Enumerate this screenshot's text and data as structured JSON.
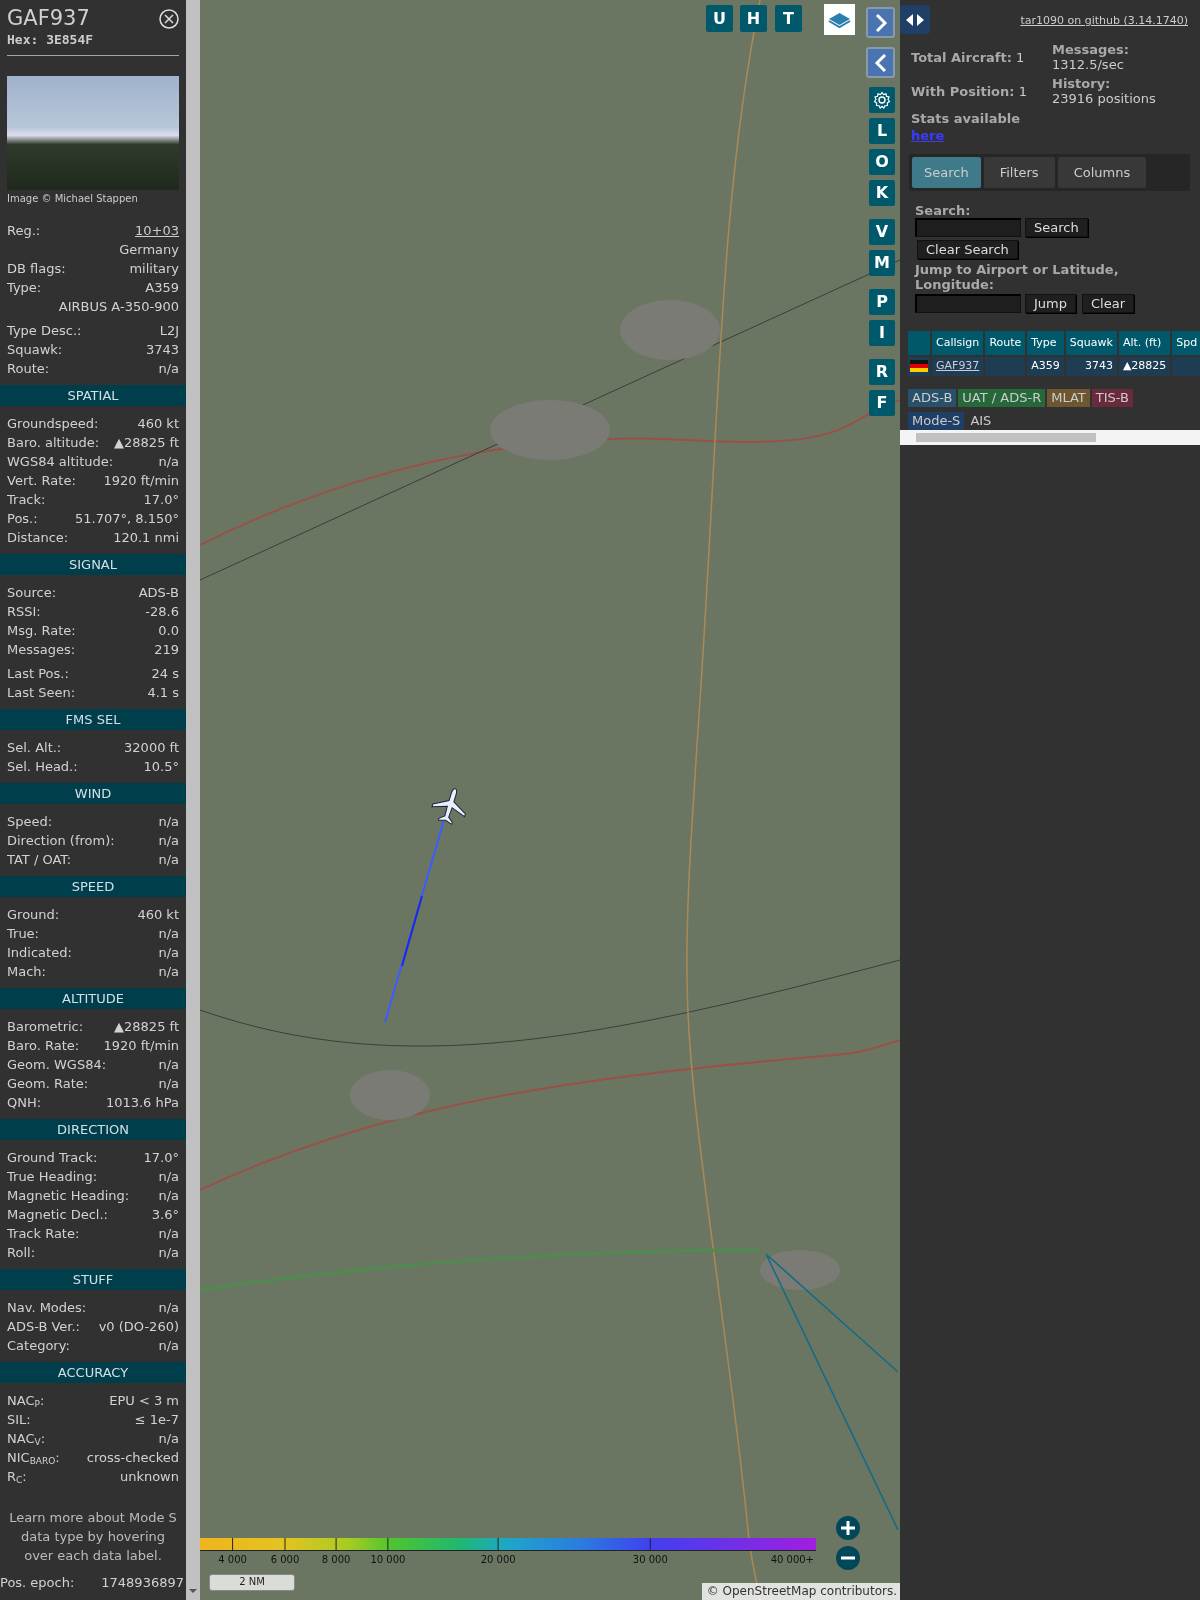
{
  "sidebar": {
    "callsign": "GAF937",
    "hex": "Hex: 3E854F",
    "photo_credit": "Image © Michael Stappen",
    "details": [
      [
        {
          "label": "Reg.:",
          "value": "10+03",
          "kind": "link"
        },
        {
          "value": "Germany",
          "kind": "plain"
        },
        {
          "label": "DB flags:",
          "value": "military",
          "kind": "plain"
        },
        {
          "label": "Type:",
          "value": "A359",
          "kind": "plain"
        },
        {
          "value": "AIRBUS A-350-900",
          "kind": "plain"
        }
      ],
      [
        {
          "label": "Type Desc.:",
          "value": "L2J",
          "kind": "plain"
        },
        {
          "label": "Squawk:",
          "value": "3743",
          "kind": "plain"
        },
        {
          "label": "Route:",
          "value": "n/a",
          "kind": "plain"
        }
      ]
    ],
    "sections": [
      {
        "title": "SPATIAL",
        "groups": [
          [
            {
              "label": "Groundspeed:",
              "value": "460 kt"
            },
            {
              "label": "Baro. altitude:",
              "value": "▲28825 ft"
            },
            {
              "label": "WGS84 altitude:",
              "value": "n/a"
            },
            {
              "label": "Vert. Rate:",
              "value": "1920 ft/min"
            },
            {
              "label": "Track:",
              "value": "17.0°"
            },
            {
              "label": "Pos.:",
              "value": "51.707°, 8.150°"
            },
            {
              "label": "Distance:",
              "value": "120.1 nmi"
            }
          ]
        ]
      },
      {
        "title": "SIGNAL",
        "groups": [
          [
            {
              "label": "Source:",
              "value": "ADS-B"
            },
            {
              "label": "RSSI:",
              "value": "-28.6"
            },
            {
              "label": "Msg. Rate:",
              "value": "0.0"
            },
            {
              "label": "Messages:",
              "value": "219"
            }
          ],
          [
            {
              "label": "Last Pos.:",
              "value": "24 s"
            },
            {
              "label": "Last Seen:",
              "value": "4.1 s"
            }
          ]
        ]
      },
      {
        "title": "FMS SEL",
        "groups": [
          [
            {
              "label": "Sel. Alt.:",
              "value": "32000 ft"
            },
            {
              "label": "Sel. Head.:",
              "value": "10.5°"
            }
          ]
        ]
      },
      {
        "title": "WIND",
        "groups": [
          [
            {
              "label": "Speed:",
              "value": "n/a"
            },
            {
              "label": "Direction (from):",
              "value": "n/a"
            },
            {
              "label": "TAT / OAT:",
              "value": "n/a"
            }
          ]
        ]
      },
      {
        "title": "SPEED",
        "groups": [
          [
            {
              "label": "Ground:",
              "value": "460 kt"
            },
            {
              "label": "True:",
              "value": "n/a"
            },
            {
              "label": "Indicated:",
              "value": "n/a"
            },
            {
              "label": "Mach:",
              "value": "n/a"
            }
          ]
        ]
      },
      {
        "title": "ALTITUDE",
        "groups": [
          [
            {
              "label": "Barometric:",
              "value": "▲28825 ft"
            },
            {
              "label": "Baro. Rate:",
              "value": "1920 ft/min"
            },
            {
              "label": "Geom. WGS84:",
              "value": "n/a"
            },
            {
              "label": "Geom. Rate:",
              "value": "n/a"
            },
            {
              "label": "QNH:",
              "value": "1013.6 hPa"
            }
          ]
        ]
      },
      {
        "title": "DIRECTION",
        "groups": [
          [
            {
              "label": "Ground Track:",
              "value": "17.0°"
            },
            {
              "label": "True Heading:",
              "value": "n/a"
            },
            {
              "label": "Magnetic Heading:",
              "value": "n/a"
            },
            {
              "label": "Magnetic Decl.:",
              "value": "3.6°"
            },
            {
              "label": "Track Rate:",
              "value": "n/a"
            },
            {
              "label": "Roll:",
              "value": "n/a"
            }
          ]
        ]
      },
      {
        "title": "STUFF",
        "groups": [
          [
            {
              "label": "Nav. Modes:",
              "value": "n/a"
            },
            {
              "label": "ADS-B Ver.:",
              "value": "v0 (DO-260)"
            },
            {
              "label": "Category:",
              "value": "n/a"
            }
          ]
        ]
      },
      {
        "title": "ACCURACY",
        "groups": [
          [
            {
              "label": "NAC$_{P}$:",
              "value": "EPU < 3 m"
            },
            {
              "label": "SIL:",
              "value": "≤ 1e-7"
            },
            {
              "label": "NAC$_{V}$:",
              "value": "n/a"
            },
            {
              "label": "NIC$_{BARO}$:",
              "value": "cross-checked"
            },
            {
              "label": "R$_{C}$:",
              "value": "unknown"
            }
          ]
        ]
      }
    ],
    "hint": "Learn more about Mode S data type by hovering over each data label.",
    "epoch": {
      "label": "Pos. epoch:",
      "value": "1748936897"
    }
  },
  "map": {
    "top_buttons": [
      "U",
      "H",
      "T"
    ],
    "side_button_groups": [
      [
        "L",
        "O",
        "K"
      ],
      [
        "V",
        "M"
      ],
      [
        "P",
        "I"
      ],
      [
        "R",
        "F"
      ]
    ],
    "altitude_legend": [
      "4 000",
      "6 000",
      "8 000",
      "10 000",
      "20 000",
      "30 000",
      "40 000+"
    ],
    "scale": "2 NM",
    "attribution": {
      "prefix": "©",
      "link": "OpenStreetMap",
      "suffix": "contributors."
    }
  },
  "panel": {
    "version_link": "tar1090 on github (3.14.1740)",
    "stats_left": [
      "**Total Aircraft:** 1",
      "**With Position:** 1"
    ],
    "stats_note": "Stats available",
    "stats_link": "here",
    "stats_right": [
      {
        "label": "Messages:",
        "value": "1312.5/sec"
      },
      {
        "label": "History:",
        "value": "23916 positions"
      }
    ],
    "tabs": [
      {
        "label": "Search",
        "selected": true
      },
      {
        "label": "Filters",
        "selected": false
      },
      {
        "label": "Columns",
        "selected": false
      }
    ],
    "search": {
      "label": "Search:",
      "button": "Search",
      "clear": "Clear Search"
    },
    "jump": {
      "label": "Jump to Airport or Latitude, Longitude:",
      "buttons": [
        "Jump",
        "Clear"
      ]
    },
    "table": {
      "columns": [
        "Callsign",
        "Route",
        "Type",
        "Squawk",
        "Alt. (ft)",
        "Spd"
      ],
      "rows": [
        {
          "callsign": "GAF937",
          "type": "A359",
          "squawk": "3743",
          "altitude": "▲28825"
        }
      ]
    },
    "source_legend": [
      {
        "label": "ADS-B",
        "color": "#28506a"
      },
      {
        "label": "UAT / ADS-R",
        "color": "#27683b"
      },
      {
        "label": "MLAT",
        "color": "#6c5731"
      },
      {
        "label": "TIS-B",
        "color": "#692a3b"
      },
      {
        "label": "Mode-S",
        "color": "#1f3f66"
      },
      {
        "label": "AIS",
        "color": "#313131"
      }
    ]
  }
}
